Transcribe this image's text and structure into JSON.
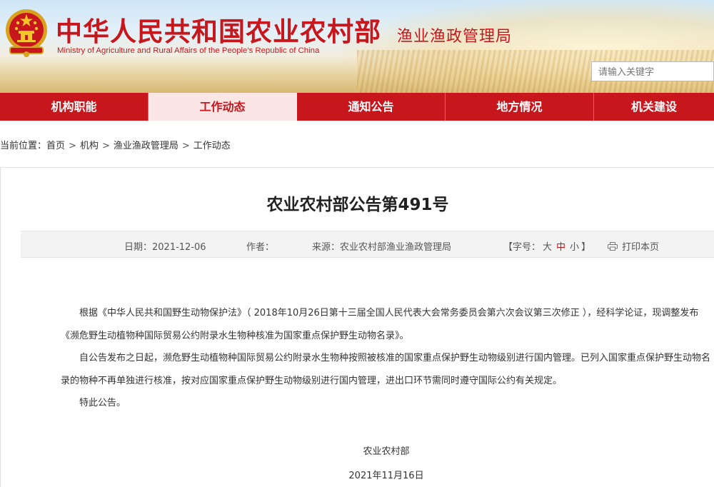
{
  "header": {
    "site_title": "中华人民共和国农业农村部",
    "site_subtitle": "Ministry of Agriculture and Rural Affairs of the People's Republic of China",
    "dept_title": "渔业渔政管理局",
    "search_placeholder": "请输入关键字",
    "emblem_icon": "national-emblem-icon",
    "brand_color": "#c8161d"
  },
  "nav": {
    "items": [
      {
        "label": "机构职能",
        "active": false
      },
      {
        "label": "工作动态",
        "active": true
      },
      {
        "label": "通知公告",
        "active": false
      },
      {
        "label": "地方情况",
        "active": false
      },
      {
        "label": "机关建设",
        "active": false
      }
    ]
  },
  "breadcrumb": {
    "prefix": "当前位置：",
    "items": [
      "首页",
      "机构",
      "渔业渔政管理局",
      "工作动态"
    ],
    "separator": ">"
  },
  "article": {
    "title": "农业农村部公告第491号",
    "meta": {
      "date_label": "日期：",
      "date": "2021-12-06",
      "author_label": "作者：",
      "author": "",
      "source_label": "来源：",
      "source": "农业农村部渔业渔政管理局",
      "font_size_open": "【字号：",
      "font_sizes": [
        "大",
        "中",
        "小"
      ],
      "font_size_current": "中",
      "font_size_close": "】",
      "print_label": "打印本页",
      "print_icon": "printer-icon"
    },
    "paragraphs": [
      "根据《中华人民共和国野生动物保护法》（ 2018年10月26日第十三届全国人民代表大会常务委员会第六次会议第三次修正 ），经科学论证，现调整发布《濒危野生动植物种国际贸易公约附录水生物种核准为国家重点保护野生动物名录》。",
      "自公告发布之日起，濒危野生动植物种国际贸易公约附录水生物种按照被核准的国家重点保护野生动物级别进行国内管理。已列入国家重点保护野生动物名录的物种不再单独进行核准，按对应国家重点保护野生动物级别进行国内管理，进出口环节需同时遵守国际公约有关规定。",
      "特此公告。"
    ],
    "signature_org": "农业农村部",
    "signature_date": "2021年11月16日"
  }
}
